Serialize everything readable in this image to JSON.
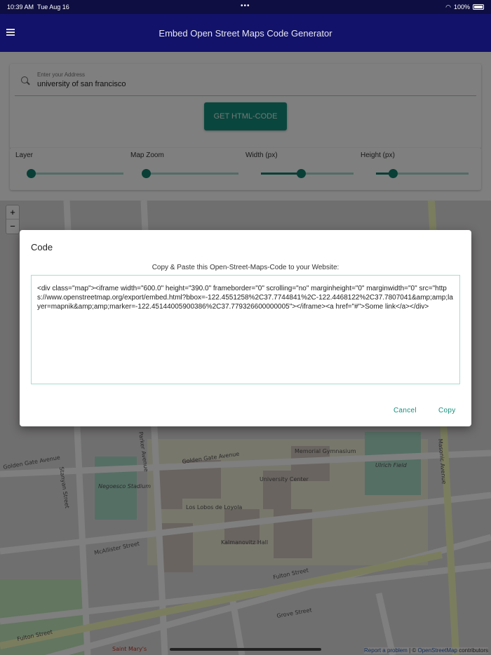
{
  "status": {
    "time": "10:39 AM",
    "date": "Tue Aug 16",
    "battery": "100%"
  },
  "header": {
    "title": "Embed Open Street Maps Code Generator"
  },
  "address": {
    "label": "Enter your Address",
    "value": "university of san francisco"
  },
  "get_button": "GET HTML-CODE",
  "sliders": [
    {
      "label": "Layer",
      "value_fraction": 0.0
    },
    {
      "label": "Map Zoom",
      "value_fraction": 0.0
    },
    {
      "label": "Width (px)",
      "value_fraction": 0.43
    },
    {
      "label": "Height (px)",
      "value_fraction": 0.18
    }
  ],
  "map": {
    "zoom_in": "+",
    "zoom_out": "−",
    "labels": [
      "Golden Gate Avenue",
      "Golden Gate Avenue",
      "Fulton Street",
      "Fulton Street",
      "McAllister Street",
      "Stanyan Street",
      "Parker Avenue",
      "Masonic Avenue",
      "Grove Street",
      "Memorial Gymnasium",
      "Ulrich Field",
      "Negoesco Stadium",
      "Los Lobos de Loyola",
      "University Center",
      "Kalmanovitz Hall",
      "Saint Mary's"
    ],
    "attribution_link": "Report a problem",
    "attribution_osm": "OpenStreetMap",
    "attribution_rest": " contributors",
    "attribution_sep": " | © "
  },
  "dialog": {
    "title": "Code",
    "subtitle": "Copy & Paste this Open-Street-Maps-Code to your Website:",
    "code": "<div class=\"map\"><iframe width=\"600.0\" height=\"390.0\" frameborder=\"0\" scrolling=\"no\" marginheight=\"0\" marginwidth=\"0\" src=\"https://www.openstreetmap.org/export/embed.html?bbox=-122.4551258%2C37.7744841%2C-122.4468122%2C37.7807041&amp;amp;layer=mapnik&amp;amp;marker=-122.45144005900386%2C37.779326600000005\"></iframe><a href=\"#\">Some link</a></div>",
    "cancel": "Cancel",
    "copy": "Copy"
  },
  "colors": {
    "header": "#12126a",
    "accent": "#128f7c"
  }
}
